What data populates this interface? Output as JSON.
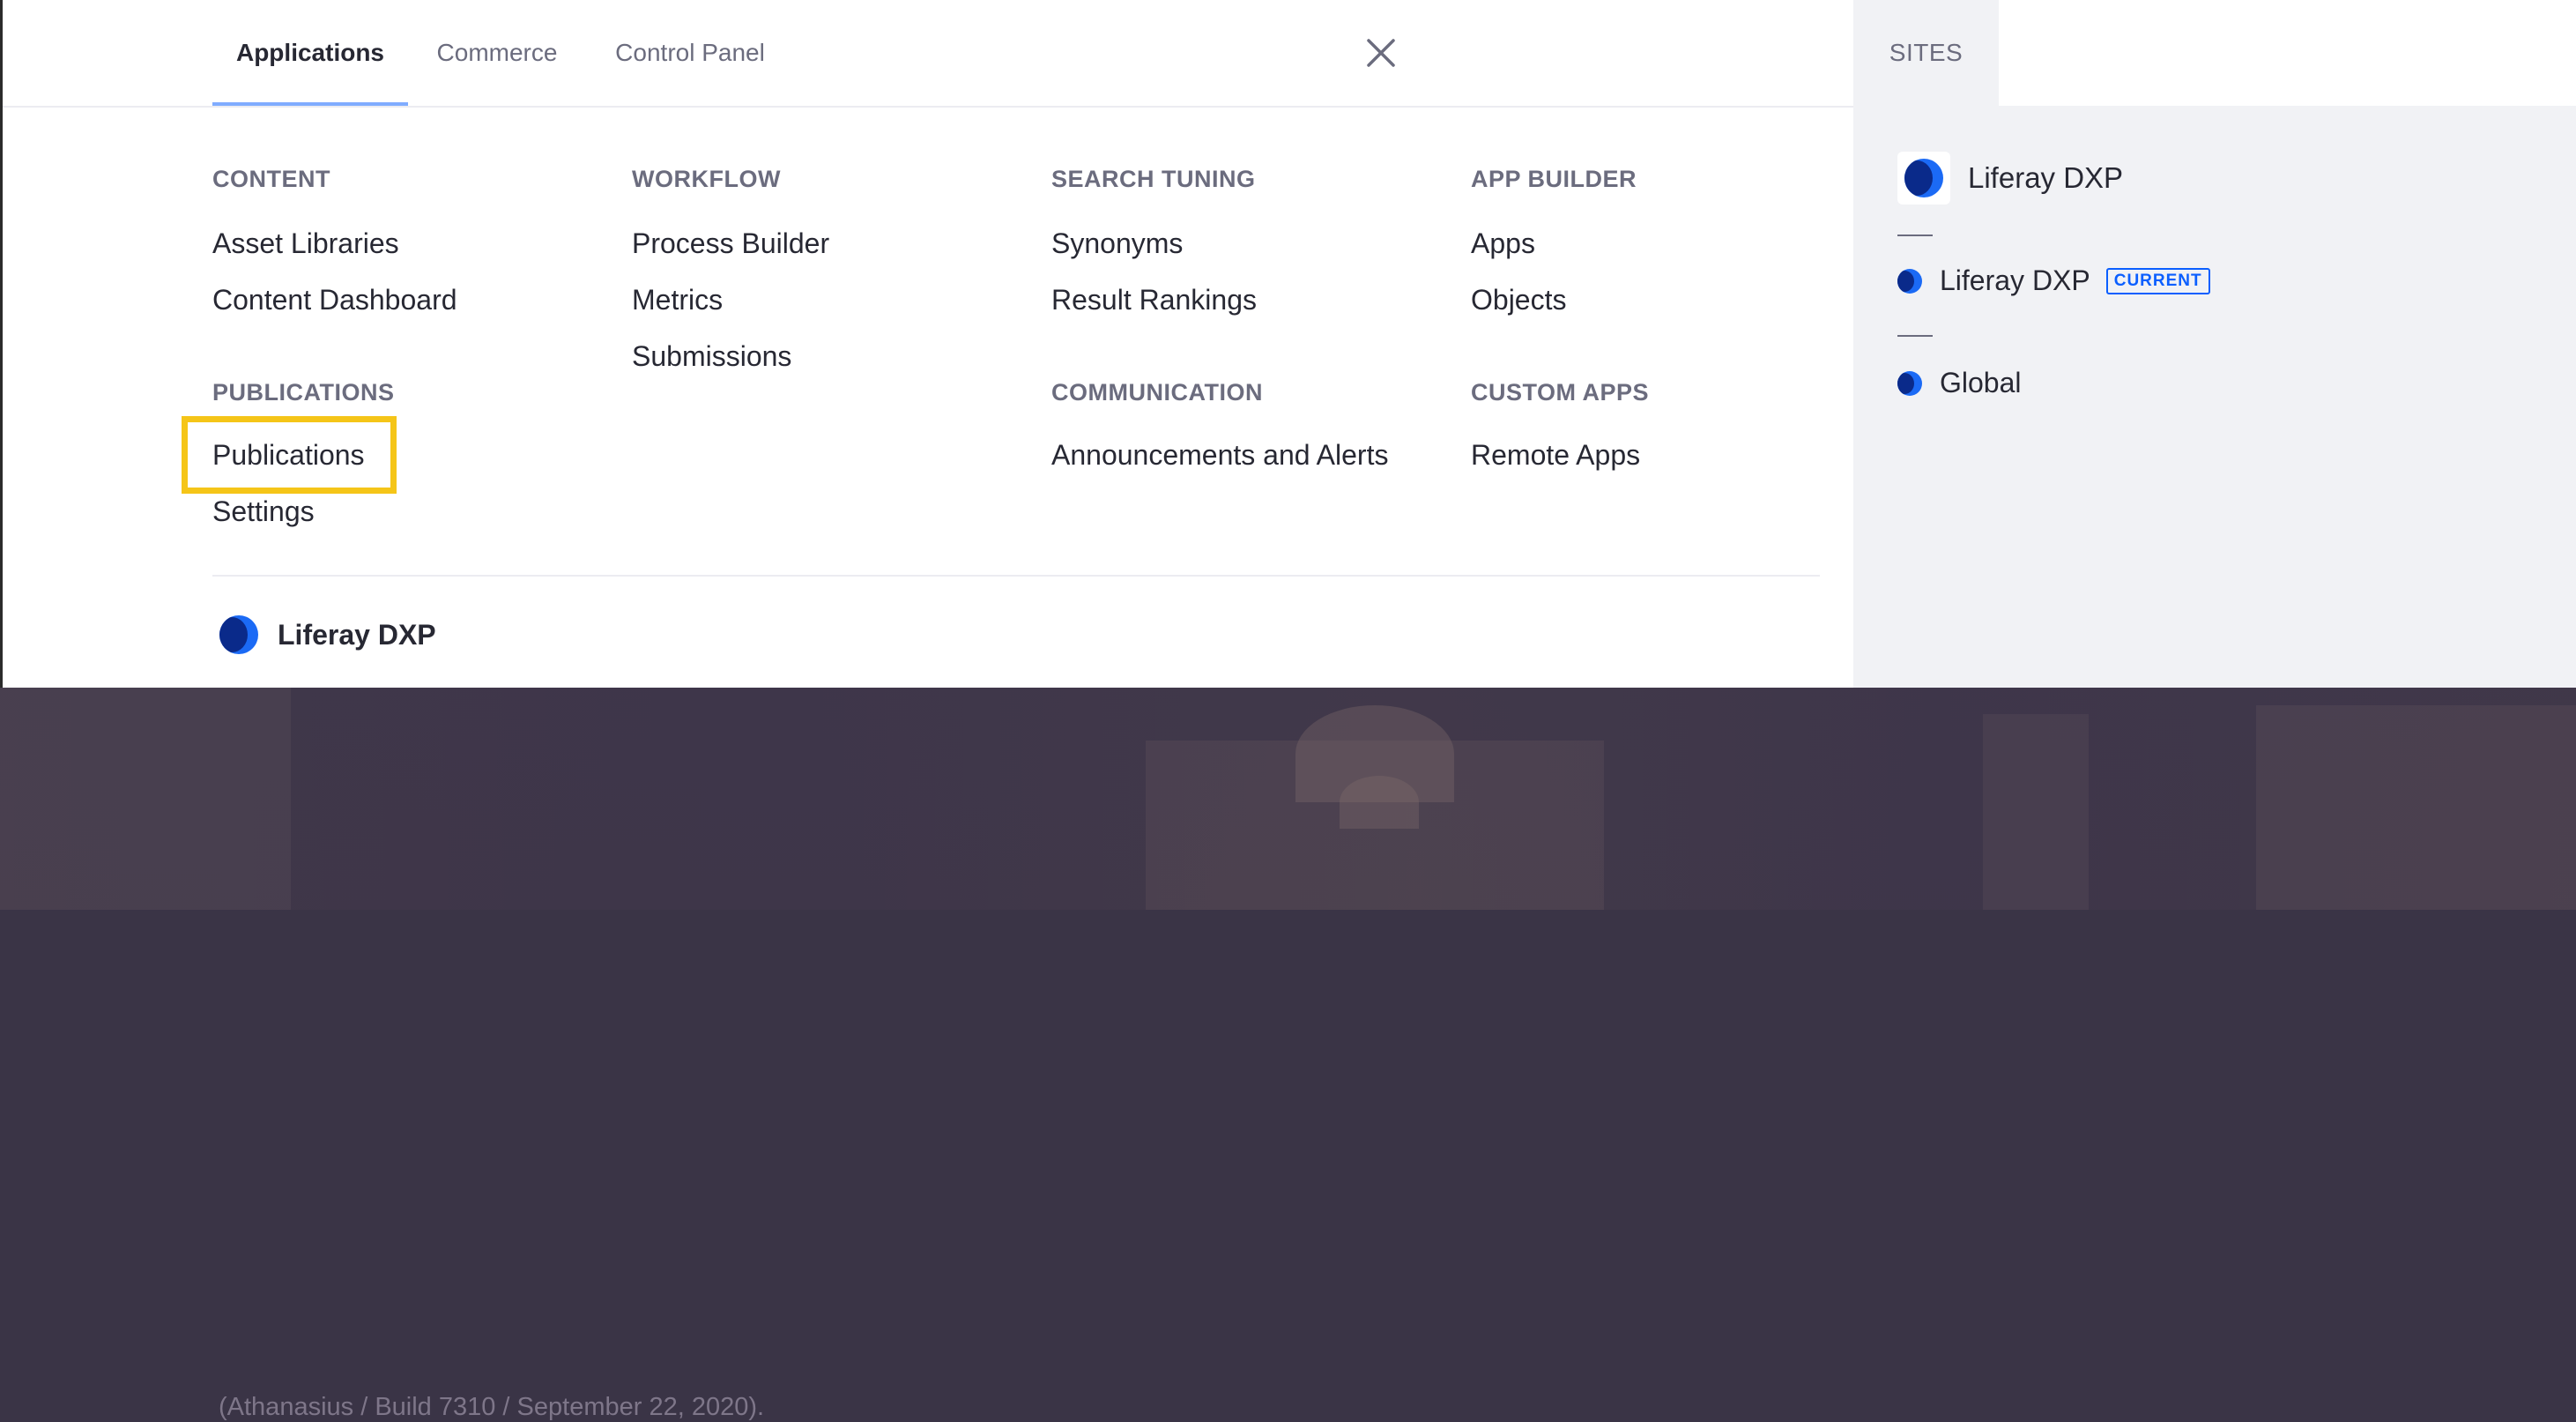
{
  "tabs": [
    {
      "label": "Applications",
      "active": true
    },
    {
      "label": "Commerce",
      "active": false
    },
    {
      "label": "Control Panel",
      "active": false
    }
  ],
  "columns": {
    "content": {
      "title": "CONTENT",
      "items": [
        "Asset Libraries",
        "Content Dashboard"
      ]
    },
    "publications": {
      "title": "PUBLICATIONS",
      "items": [
        "Publications",
        "Settings"
      ]
    },
    "workflow": {
      "title": "WORKFLOW",
      "items": [
        "Process Builder",
        "Metrics",
        "Submissions"
      ]
    },
    "search_tuning": {
      "title": "SEARCH TUNING",
      "items": [
        "Synonyms",
        "Result Rankings"
      ]
    },
    "communication": {
      "title": "COMMUNICATION",
      "items": [
        "Announcements and Alerts"
      ]
    },
    "app_builder": {
      "title": "APP BUILDER",
      "items": [
        "Apps",
        "Objects"
      ]
    },
    "custom_apps": {
      "title": "CUSTOM APPS",
      "items": [
        "Remote Apps"
      ]
    }
  },
  "footer": {
    "site_name": "Liferay DXP"
  },
  "sites_panel": {
    "title": "SITES",
    "close_icon": "close-icon",
    "main_site": "Liferay DXP",
    "current_site": "Liferay DXP",
    "current_badge": "CURRENT",
    "global_site": "Global"
  },
  "background": {
    "caption": "(Athanasius / Build 7310 / September 22, 2020)."
  },
  "colors": {
    "accent": "#80acff",
    "highlight": "#f5c518",
    "brand_blue": "#0b5fff",
    "text_primary": "#272833",
    "text_secondary": "#6b6c7e"
  }
}
